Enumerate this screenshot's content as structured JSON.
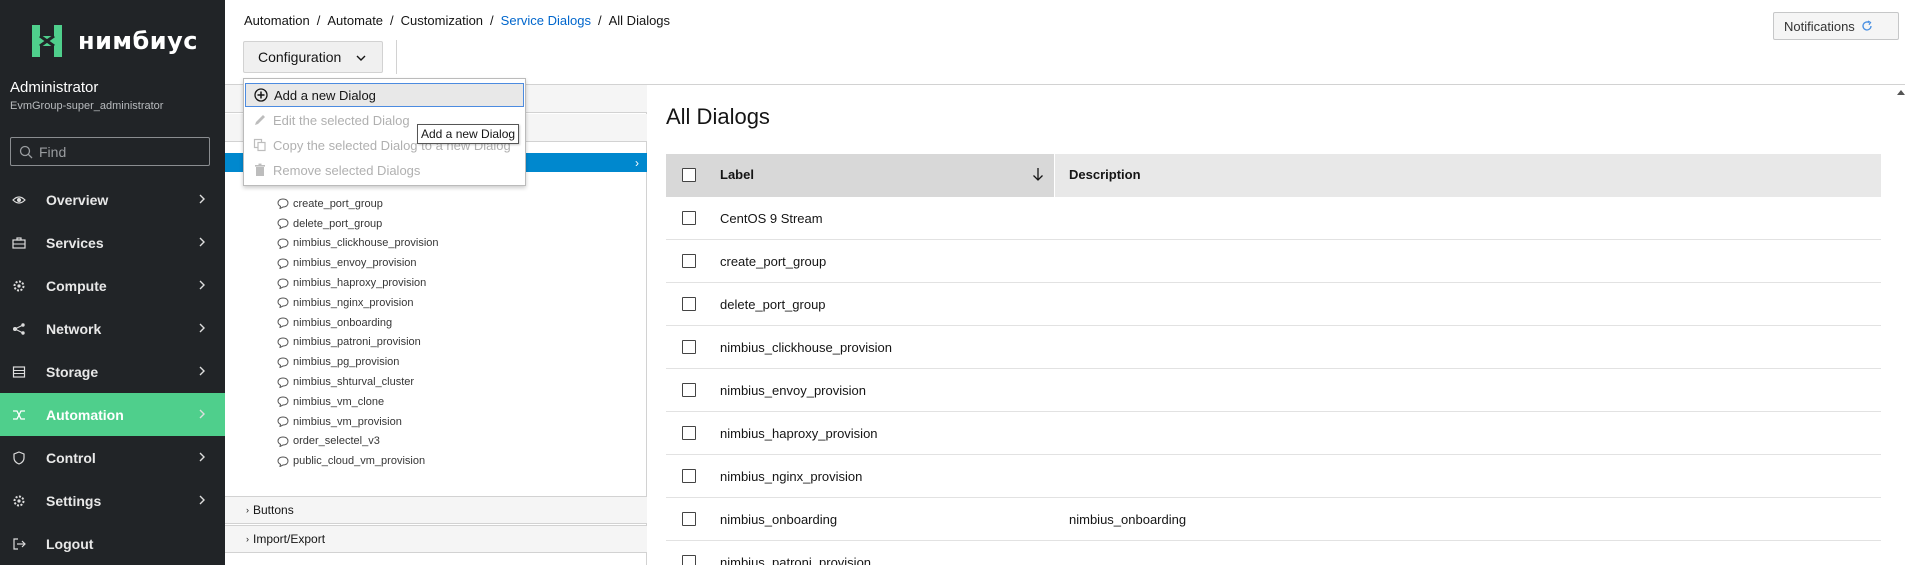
{
  "brand": {
    "name": "нимбиус"
  },
  "user": {
    "name": "Administrator",
    "group": "EvmGroup-super_administrator"
  },
  "search": {
    "placeholder": "Find"
  },
  "nav": [
    {
      "label": "Overview",
      "icon": "eye-icon"
    },
    {
      "label": "Services",
      "icon": "briefcase-icon"
    },
    {
      "label": "Compute",
      "icon": "gear-icon"
    },
    {
      "label": "Network",
      "icon": "network-icon"
    },
    {
      "label": "Storage",
      "icon": "storage-icon"
    },
    {
      "label": "Automation",
      "icon": "automation-icon",
      "active": true
    },
    {
      "label": "Control",
      "icon": "shield-icon"
    },
    {
      "label": "Settings",
      "icon": "settings-icon"
    },
    {
      "label": "Logout",
      "icon": "logout-icon"
    }
  ],
  "breadcrumb": {
    "items": [
      "Automation",
      "Automate",
      "Customization"
    ],
    "link": "Service Dialogs",
    "current": "All Dialogs"
  },
  "notifications": {
    "label": "Notifications"
  },
  "toolbar": {
    "config_label": "Configuration"
  },
  "dropdown": {
    "items": [
      {
        "label": "Add a new Dialog",
        "enabled": true
      },
      {
        "label": "Edit the selected Dialog",
        "enabled": false
      },
      {
        "label": "Copy the selected Dialog to a new Dialog",
        "enabled": false
      },
      {
        "label": "Remove selected Dialogs",
        "enabled": false
      }
    ]
  },
  "tooltip": {
    "text": "Add a new Dialog"
  },
  "tree": {
    "items": [
      "create_port_group",
      "delete_port_group",
      "nimbius_clickhouse_provision",
      "nimbius_envoy_provision",
      "nimbius_haproxy_provision",
      "nimbius_nginx_provision",
      "nimbius_onboarding",
      "nimbius_patroni_provision",
      "nimbius_pg_provision",
      "nimbius_shturval_cluster",
      "nimbius_vm_clone",
      "nimbius_vm_provision",
      "order_selectel_v3",
      "public_cloud_vm_provision"
    ]
  },
  "accordion": {
    "buttons": "Buttons",
    "import_export": "Import/Export"
  },
  "main": {
    "title": "All Dialogs",
    "columns": {
      "label": "Label",
      "description": "Description"
    },
    "rows": [
      {
        "label": "CentOS 9 Stream",
        "description": ""
      },
      {
        "label": "create_port_group",
        "description": ""
      },
      {
        "label": "delete_port_group",
        "description": ""
      },
      {
        "label": "nimbius_clickhouse_provision",
        "description": ""
      },
      {
        "label": "nimbius_envoy_provision",
        "description": ""
      },
      {
        "label": "nimbius_haproxy_provision",
        "description": ""
      },
      {
        "label": "nimbius_nginx_provision",
        "description": ""
      },
      {
        "label": "nimbius_onboarding",
        "description": "nimbius_onboarding"
      },
      {
        "label": "nimbius_patroni_provision",
        "description": ""
      }
    ]
  },
  "colors": {
    "sidebar": "#212427",
    "active_nav": "#4fcf8c",
    "link": "#0066cc",
    "tree_selected": "#0088ce"
  }
}
